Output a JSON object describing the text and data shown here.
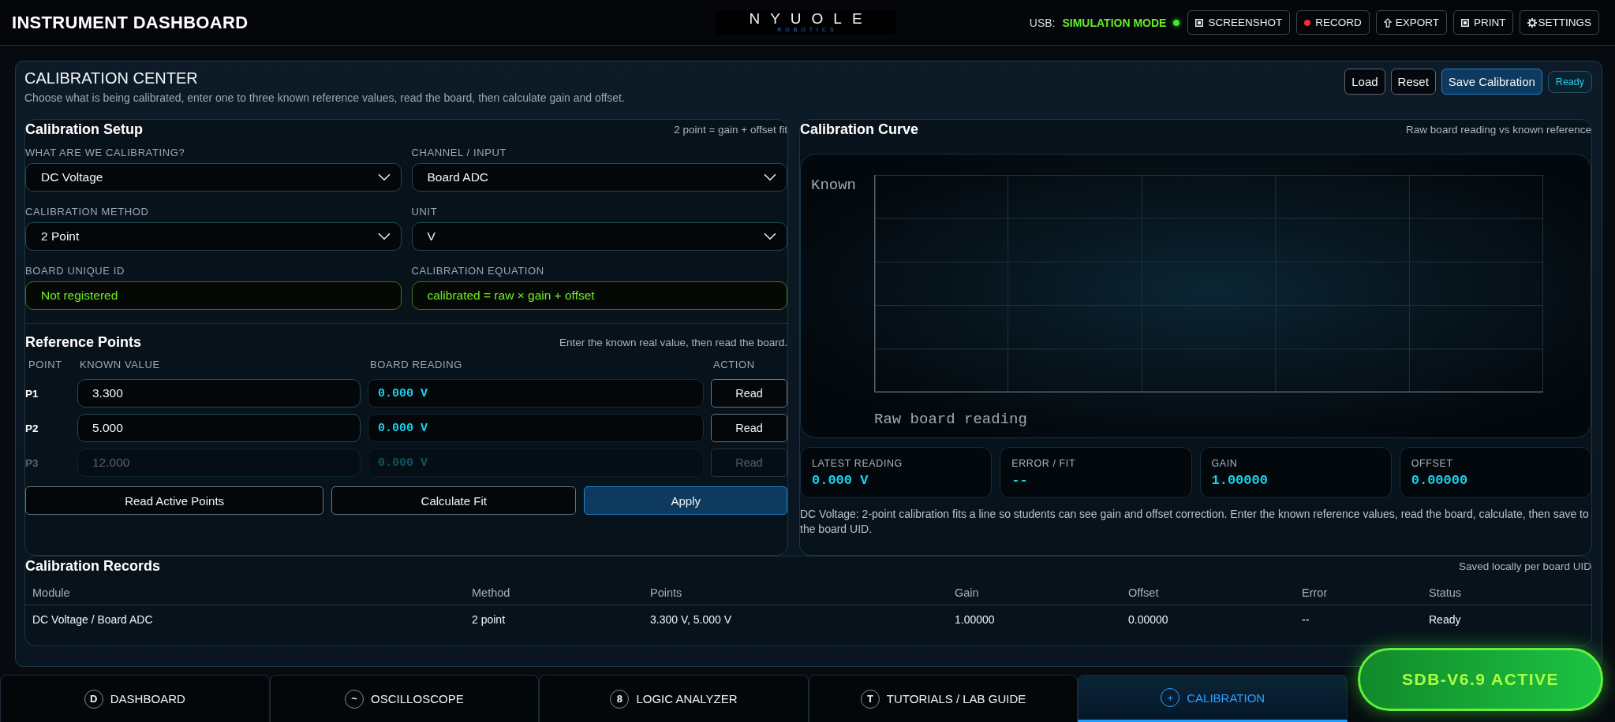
{
  "header": {
    "title": "INSTRUMENT DASHBOARD",
    "logo": {
      "wordmark": "NYUOLE",
      "tagline": "ROBOTICS"
    },
    "usb_label": "USB:",
    "usb_mode": "SIMULATION MODE",
    "connected": true,
    "buttons": [
      {
        "kind": "screenshot",
        "label": "SCREENSHOT"
      },
      {
        "kind": "record",
        "label": "RECORD"
      },
      {
        "kind": "export",
        "label": "EXPORT"
      },
      {
        "kind": "print",
        "label": "PRINT"
      },
      {
        "kind": "settings",
        "label": "SETTINGS"
      }
    ]
  },
  "calibration_center": {
    "title": "CALIBRATION CENTER",
    "subtitle": "Choose what is being calibrated, enter one to three known reference values, read the board, then calculate gain and offset.",
    "actions": [
      {
        "label": "Load",
        "primary": false
      },
      {
        "label": "Reset",
        "primary": false
      },
      {
        "label": "Save Calibration",
        "primary": true
      }
    ],
    "status": "Ready"
  },
  "setup": {
    "title": "Calibration Setup",
    "note": "2 point = gain + offset fit",
    "fields": [
      {
        "label": "WHAT ARE WE CALIBRATING?",
        "kind": "select",
        "value": "DC Voltage"
      },
      {
        "label": "CHANNEL / INPUT",
        "kind": "select",
        "value": "Board ADC"
      },
      {
        "label": "CALIBRATION METHOD",
        "kind": "select",
        "value": "2 Point"
      },
      {
        "label": "UNIT",
        "kind": "select",
        "value": "V"
      },
      {
        "label": "BOARD UNIQUE ID",
        "kind": "readout",
        "value": "Not registered"
      },
      {
        "label": "CALIBRATION EQUATION",
        "kind": "readout",
        "value": "calibrated = raw × gain + offset"
      }
    ]
  },
  "reference_points": {
    "title": "Reference Points",
    "note": "Enter the known real value, then read the board.",
    "columns": [
      "POINT",
      "KNOWN VALUE",
      "BOARD READING",
      "ACTION"
    ],
    "rows": [
      {
        "point": "P1",
        "known_value": "3.300",
        "reading": "0.000 V",
        "action": "Read",
        "disabled": false
      },
      {
        "point": "P2",
        "known_value": "5.000",
        "reading": "0.000 V",
        "action": "Read",
        "disabled": false
      },
      {
        "point": "P3",
        "known_value": "12.000",
        "reading": "0.000 V",
        "action": "Read",
        "disabled": true
      }
    ],
    "buttons": [
      {
        "label": "Read Active Points",
        "primary": false
      },
      {
        "label": "Calculate Fit",
        "primary": false
      },
      {
        "label": "Apply",
        "primary": true
      }
    ]
  },
  "curve": {
    "title": "Calibration Curve",
    "note": "Raw board reading vs known reference",
    "y_axis_label": "Known",
    "x_axis_label": "Raw board reading",
    "stats": [
      {
        "label": "LATEST READING",
        "value": "0.000 V"
      },
      {
        "label": "ERROR / FIT",
        "value": "--"
      },
      {
        "label": "GAIN",
        "value": "1.00000"
      },
      {
        "label": "OFFSET",
        "value": "0.00000"
      }
    ],
    "description": "DC Voltage: 2-point calibration fits a line so students can see gain and offset correction. Enter the known reference values, read the board, calculate, then save to the board UID."
  },
  "records": {
    "title": "Calibration Records",
    "note": "Saved locally per board UID",
    "columns": [
      "Module",
      "Method",
      "Points",
      "Gain",
      "Offset",
      "Error",
      "Status"
    ],
    "rows": [
      [
        "DC Voltage / Board ADC",
        "2 point",
        "3.300 V, 5.000 V",
        "1.00000",
        "0.00000",
        "--",
        "Ready"
      ]
    ]
  },
  "nav": {
    "tabs": [
      {
        "icon": "D",
        "label": "DASHBOARD",
        "selected": false
      },
      {
        "icon": "~",
        "label": "OSCILLOSCOPE",
        "selected": false
      },
      {
        "icon": "8",
        "label": "LOGIC ANALYZER",
        "selected": false
      },
      {
        "icon": "T",
        "label": "TUTORIALS / LAB GUIDE",
        "selected": false
      },
      {
        "icon": "+",
        "label": "CALIBRATION",
        "selected": true
      }
    ]
  },
  "version_badge": "SDB-V6.9 ACTIVE"
}
